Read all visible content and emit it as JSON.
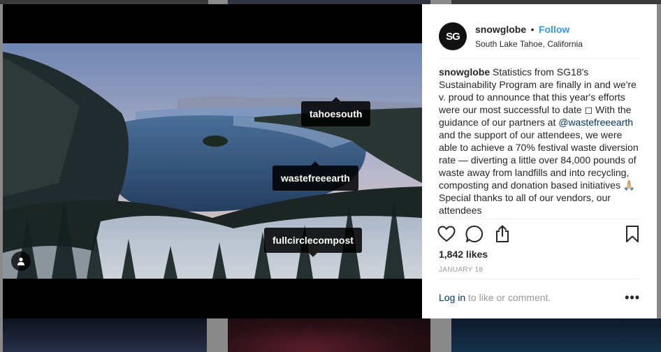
{
  "post": {
    "username": "snowglobe",
    "avatar_text": "SG",
    "separator": "•",
    "follow_label": "Follow",
    "location": "South Lake Tahoe, California",
    "caption_parts": {
      "username": "snowglobe",
      "text_1": " Statistics from SG18's Sustainability Program are finally in and we're v. proud to announce that this year's efforts were our most successful to date ◻ With the guidance of our partners at ",
      "mention": "@wastefreeearth",
      "text_2": " and the support of our attendees, we were able to achieve a 70% festival waste diversion rate — diverting a little over 84,000 pounds of waste away from landfills and into recycling, composting and donation based initiatives 🙏🏼 Special thanks to all of our vendors, our attendees"
    },
    "likes": "1,842 likes",
    "date": "JANUARY 18",
    "login_link": "Log in",
    "login_rest": " to like or comment.",
    "more_options": "•••"
  },
  "tags": [
    {
      "label": "tahoesouth"
    },
    {
      "label": "wastefreeearth"
    },
    {
      "label": "fullcirclecompost"
    }
  ],
  "icons": {
    "like": "heart-icon",
    "comment": "comment-icon",
    "share": "share-icon",
    "save": "bookmark-icon",
    "tagged_people": "person-icon"
  },
  "colors": {
    "link_blue": "#3897f0",
    "mention_blue": "#003569",
    "text": "#262626",
    "muted": "#999999"
  }
}
